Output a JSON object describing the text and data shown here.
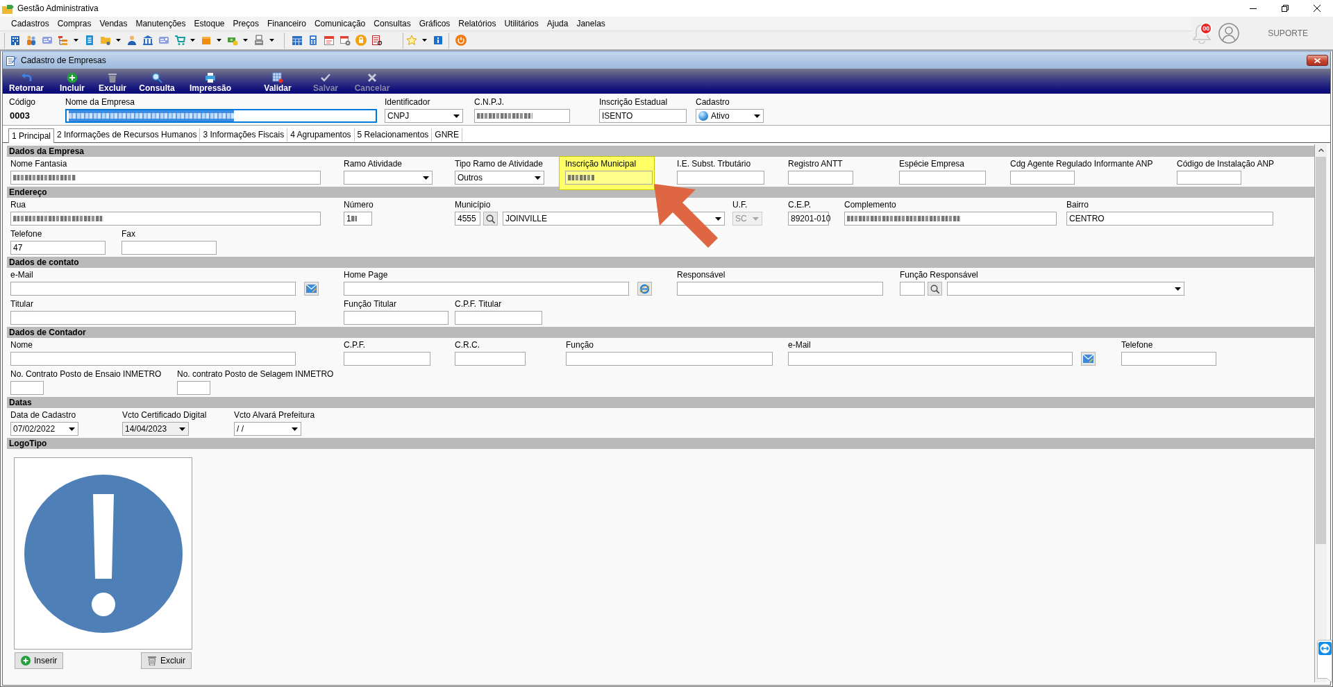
{
  "window": {
    "title": "Gestão Administrativa"
  },
  "menu": [
    "Cadastros",
    "Compras",
    "Vendas",
    "Manutenções",
    "Estoque",
    "Preços",
    "Financeiro",
    "Comunicação",
    "Consultas",
    "Gráficos",
    "Relatórios",
    "Utilitários",
    "Ajuda",
    "Janelas"
  ],
  "notifications": {
    "count": "00"
  },
  "user": {
    "name": "SUPORTE"
  },
  "child_window": {
    "title": "Cadastro de Empresas",
    "actions": [
      {
        "kind": "return",
        "label": "Retornar",
        "disabled": false
      },
      {
        "kind": "add",
        "label": "Incluir",
        "disabled": false
      },
      {
        "kind": "delete",
        "label": "Excluir",
        "disabled": false
      },
      {
        "kind": "search",
        "label": "Consulta",
        "disabled": false
      },
      {
        "kind": "print",
        "label": "Impressão",
        "disabled": false
      },
      {
        "kind": "validate",
        "label": "Validar",
        "disabled": false
      },
      {
        "kind": "save",
        "label": "Salvar",
        "disabled": true
      },
      {
        "kind": "cancel",
        "label": "Cancelar",
        "disabled": true
      }
    ],
    "header": [
      {
        "kind": "static",
        "label": "Código",
        "value": "0003"
      },
      {
        "kind": "text",
        "label": "Nome da Empresa",
        "redacted": true,
        "focused": true
      },
      {
        "kind": "select",
        "label": "Identificador",
        "value": "CNPJ"
      },
      {
        "kind": "text",
        "label": "C.N.P.J.",
        "redacted": true
      },
      {
        "kind": "text",
        "label": "Inscrição Estadual",
        "value": "ISENTO"
      },
      {
        "kind": "status_select",
        "label": "Cadastro",
        "value": "Ativo"
      }
    ],
    "tabs": [
      {
        "label": "1 Principal",
        "selected": true
      },
      {
        "label": "2 Informações de Recursos Humanos",
        "selected": false
      },
      {
        "label": "3 Informações Fiscais",
        "selected": false
      },
      {
        "label": "4 Agrupamentos",
        "selected": false
      },
      {
        "label": "5 Relacionamentos",
        "selected": false
      },
      {
        "label": "GNRE",
        "selected": false
      }
    ],
    "sections": [
      {
        "kind": "fields",
        "title": "Dados da Empresa",
        "rows": [
          [
            {
              "kind": "text",
              "label": "Nome Fantasia",
              "redacted": true
            },
            {
              "kind": "select",
              "label": "Ramo Atividade"
            },
            {
              "kind": "select",
              "label": "Tipo Ramo de Atividade",
              "value": "Outros"
            },
            {
              "kind": "text",
              "label": "Inscrição Municipal",
              "redacted": true,
              "highlighted": true
            },
            {
              "kind": "text",
              "label": "I.E. Subst. Trbutário"
            },
            {
              "kind": "text",
              "label": "Registro ANTT"
            },
            {
              "kind": "text",
              "label": "Espécie Empresa"
            },
            {
              "kind": "text",
              "label": "Cdg Agente Regulado Informante ANP"
            },
            {
              "kind": "text",
              "label": "Código de Instalação ANP"
            }
          ]
        ]
      },
      {
        "kind": "fields",
        "title": "Endereço",
        "rows": [
          [
            {
              "kind": "text",
              "label": "Rua",
              "redacted": true
            },
            {
              "kind": "text",
              "label": "Número",
              "value": "1",
              "redacted": true
            },
            {
              "kind": "lookup",
              "label": "Município",
              "code": "4555",
              "value": "JOINVILLE"
            },
            {
              "kind": "select",
              "label": "U.F.",
              "value": "SC",
              "disabled": true
            },
            {
              "kind": "text",
              "label": "C.E.P.",
              "value": "89201-010"
            },
            {
              "kind": "text",
              "label": "Complemento",
              "redacted": true
            },
            {
              "kind": "text",
              "label": "Bairro",
              "value": "CENTRO"
            }
          ],
          [
            {
              "kind": "text",
              "label": "Telefone",
              "value": "47"
            },
            {
              "kind": "text",
              "label": "Fax"
            }
          ]
        ]
      },
      {
        "kind": "fields",
        "title": "Dados de contato",
        "rows": [
          [
            {
              "kind": "email",
              "label": "e-Mail"
            },
            {
              "kind": "url",
              "label": "Home Page"
            },
            {
              "kind": "text",
              "label": "Responsável"
            },
            {
              "kind": "lookup",
              "label": "Função Responsável"
            }
          ],
          [
            {
              "kind": "text",
              "label": "Titular"
            },
            {
              "kind": "text",
              "label": "Função Titular"
            },
            {
              "kind": "text",
              "label": "C.P.F. Titular"
            }
          ]
        ]
      },
      {
        "kind": "fields",
        "title": "Dados de Contador",
        "rows": [
          [
            {
              "kind": "text",
              "label": "Nome"
            },
            {
              "kind": "text",
              "label": "C.P.F."
            },
            {
              "kind": "text",
              "label": "C.R.C."
            },
            {
              "kind": "text",
              "label": "Função"
            },
            {
              "kind": "email",
              "label": "e-Mail"
            },
            {
              "kind": "text",
              "label": "Telefone"
            }
          ],
          [
            {
              "kind": "text",
              "label": "No. Contrato Posto de Ensaio INMETRO"
            },
            {
              "kind": "text",
              "label": "No. contrato Posto de Selagem INMETRO"
            }
          ]
        ]
      },
      {
        "kind": "fields",
        "title": "Datas",
        "rows": [
          [
            {
              "kind": "date",
              "label": "Data de Cadastro",
              "value": "07/02/2022"
            },
            {
              "kind": "date",
              "label": "Vcto Certificado Digital",
              "value": "14/04/2023",
              "readonly": true
            },
            {
              "kind": "date",
              "label": "Vcto Alvará Prefeitura",
              "value": "/ /"
            }
          ]
        ]
      },
      {
        "kind": "logo",
        "title": "LogoTipo",
        "buttons": [
          {
            "kind": "add",
            "label": "Inserir"
          },
          {
            "kind": "delete",
            "label": "Excluir"
          }
        ]
      }
    ],
    "annotations": [
      {
        "kind": "arrow"
      }
    ]
  }
}
